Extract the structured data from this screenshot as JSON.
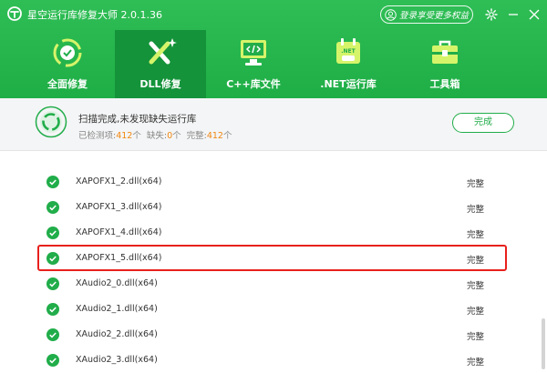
{
  "app": {
    "title": "星空运行库修复大师 2.0.1.36"
  },
  "login": {
    "label": "登录享受更多权益"
  },
  "tabs": [
    {
      "label": "全面修复",
      "icon": "recycle-icon",
      "active": false
    },
    {
      "label": "DLL修复",
      "icon": "tools-sparkle-icon",
      "active": true
    },
    {
      "label": "C++库文件",
      "icon": "code-monitor-icon",
      "active": false
    },
    {
      "label": ".NET运行库",
      "icon": "net-calendar-icon",
      "active": false
    },
    {
      "label": "工具箱",
      "icon": "toolbox-icon",
      "active": false
    }
  ],
  "status": {
    "title": "扫描完成,未发现缺失运行库",
    "checked_label": "已检测项:",
    "checked_value": "412",
    "missing_label": "缺失:",
    "missing_value": "0",
    "complete_label": "完整:",
    "complete_value": "412",
    "unit": "个",
    "button": "完成"
  },
  "files": [
    {
      "name": "XAPOFX1_2.dll(x64)",
      "status": "完整"
    },
    {
      "name": "XAPOFX1_3.dll(x64)",
      "status": "完整"
    },
    {
      "name": "XAPOFX1_4.dll(x64)",
      "status": "完整"
    },
    {
      "name": "XAPOFX1_5.dll(x64)",
      "status": "完整",
      "highlighted": true
    },
    {
      "name": "XAudio2_0.dll(x64)",
      "status": "完整"
    },
    {
      "name": "XAudio2_1.dll(x64)",
      "status": "完整"
    },
    {
      "name": "XAudio2_2.dll(x64)",
      "status": "完整"
    },
    {
      "name": "XAudio2_3.dll(x64)",
      "status": "完整"
    }
  ],
  "colors": {
    "brand_green": "#21ad4a",
    "active_tab": "#14933a",
    "highlight_red": "#e8201c",
    "count_orange": "#f0860e"
  }
}
